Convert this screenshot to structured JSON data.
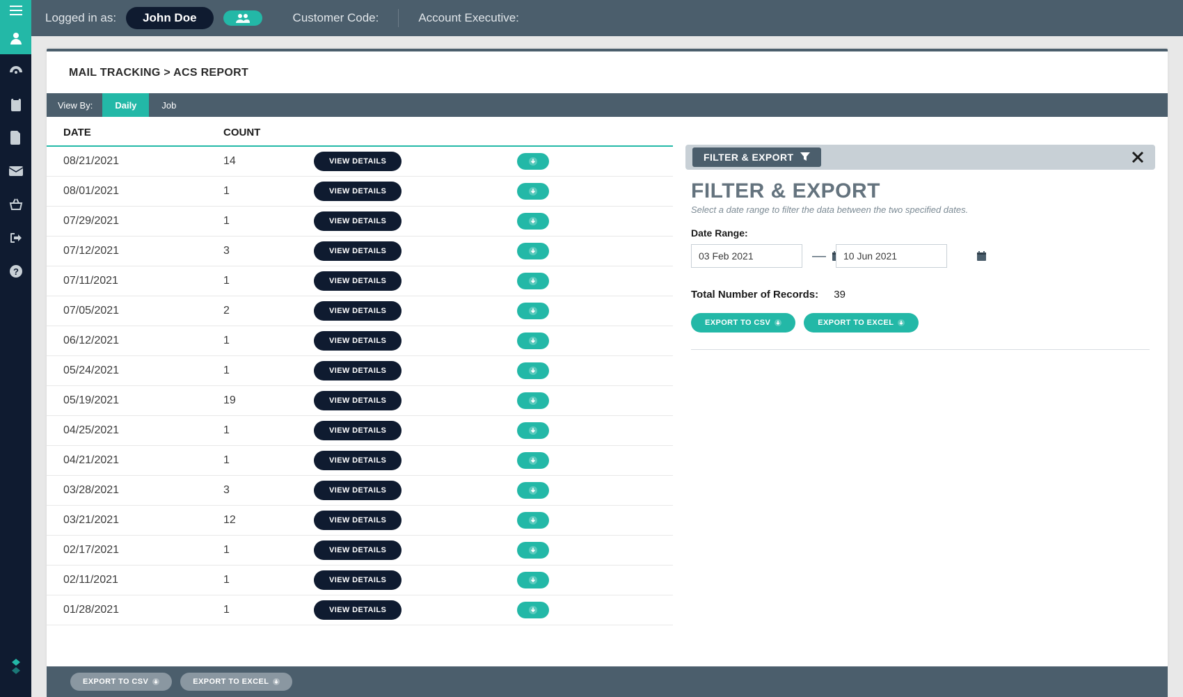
{
  "topbar": {
    "logged_in_label": "Logged in as:",
    "user_name": "John Doe",
    "customer_code_label": "Customer Code:",
    "account_exec_label": "Account Executive:"
  },
  "sidebar": {
    "items": [
      "menu",
      "user",
      "dashboard",
      "clipboard",
      "document",
      "mail",
      "basket",
      "logout",
      "help"
    ]
  },
  "breadcrumb": {
    "section": "MAIL TRACKING",
    "page": "ACS REPORT"
  },
  "viewby": {
    "label": "View By:",
    "tabs": [
      {
        "label": "Daily",
        "active": true
      },
      {
        "label": "Job",
        "active": false
      }
    ]
  },
  "table": {
    "headers": {
      "date": "DATE",
      "count": "COUNT"
    },
    "view_details_label": "VIEW DETAILS",
    "rows": [
      {
        "date": "08/21/2021",
        "count": "14"
      },
      {
        "date": "08/01/2021",
        "count": "1"
      },
      {
        "date": "07/29/2021",
        "count": "1"
      },
      {
        "date": "07/12/2021",
        "count": "3"
      },
      {
        "date": "07/11/2021",
        "count": "1"
      },
      {
        "date": "07/05/2021",
        "count": "2"
      },
      {
        "date": "06/12/2021",
        "count": "1"
      },
      {
        "date": "05/24/2021",
        "count": "1"
      },
      {
        "date": "05/19/2021",
        "count": "19"
      },
      {
        "date": "04/25/2021",
        "count": "1"
      },
      {
        "date": "04/21/2021",
        "count": "1"
      },
      {
        "date": "03/28/2021",
        "count": "3"
      },
      {
        "date": "03/21/2021",
        "count": "12"
      },
      {
        "date": "02/17/2021",
        "count": "1"
      },
      {
        "date": "02/11/2021",
        "count": "1"
      },
      {
        "date": "01/28/2021",
        "count": "1"
      }
    ]
  },
  "filter": {
    "chip_label": "FILTER & EXPORT",
    "title": "FILTER & EXPORT",
    "subtitle": "Select a date range to filter the data between the two specified dates.",
    "date_range_label": "Date Range:",
    "date_from": "03 Feb 2021",
    "date_to": "10 Jun 2021",
    "records_label": "Total Number of Records:",
    "records_value": "39",
    "export_csv_label": "EXPORT TO CSV",
    "export_excel_label": "EXPORT TO EXCEL"
  },
  "footer": {
    "export_csv_label": "EXPORT TO CSV",
    "export_excel_label": "EXPORT TO EXCEL"
  }
}
